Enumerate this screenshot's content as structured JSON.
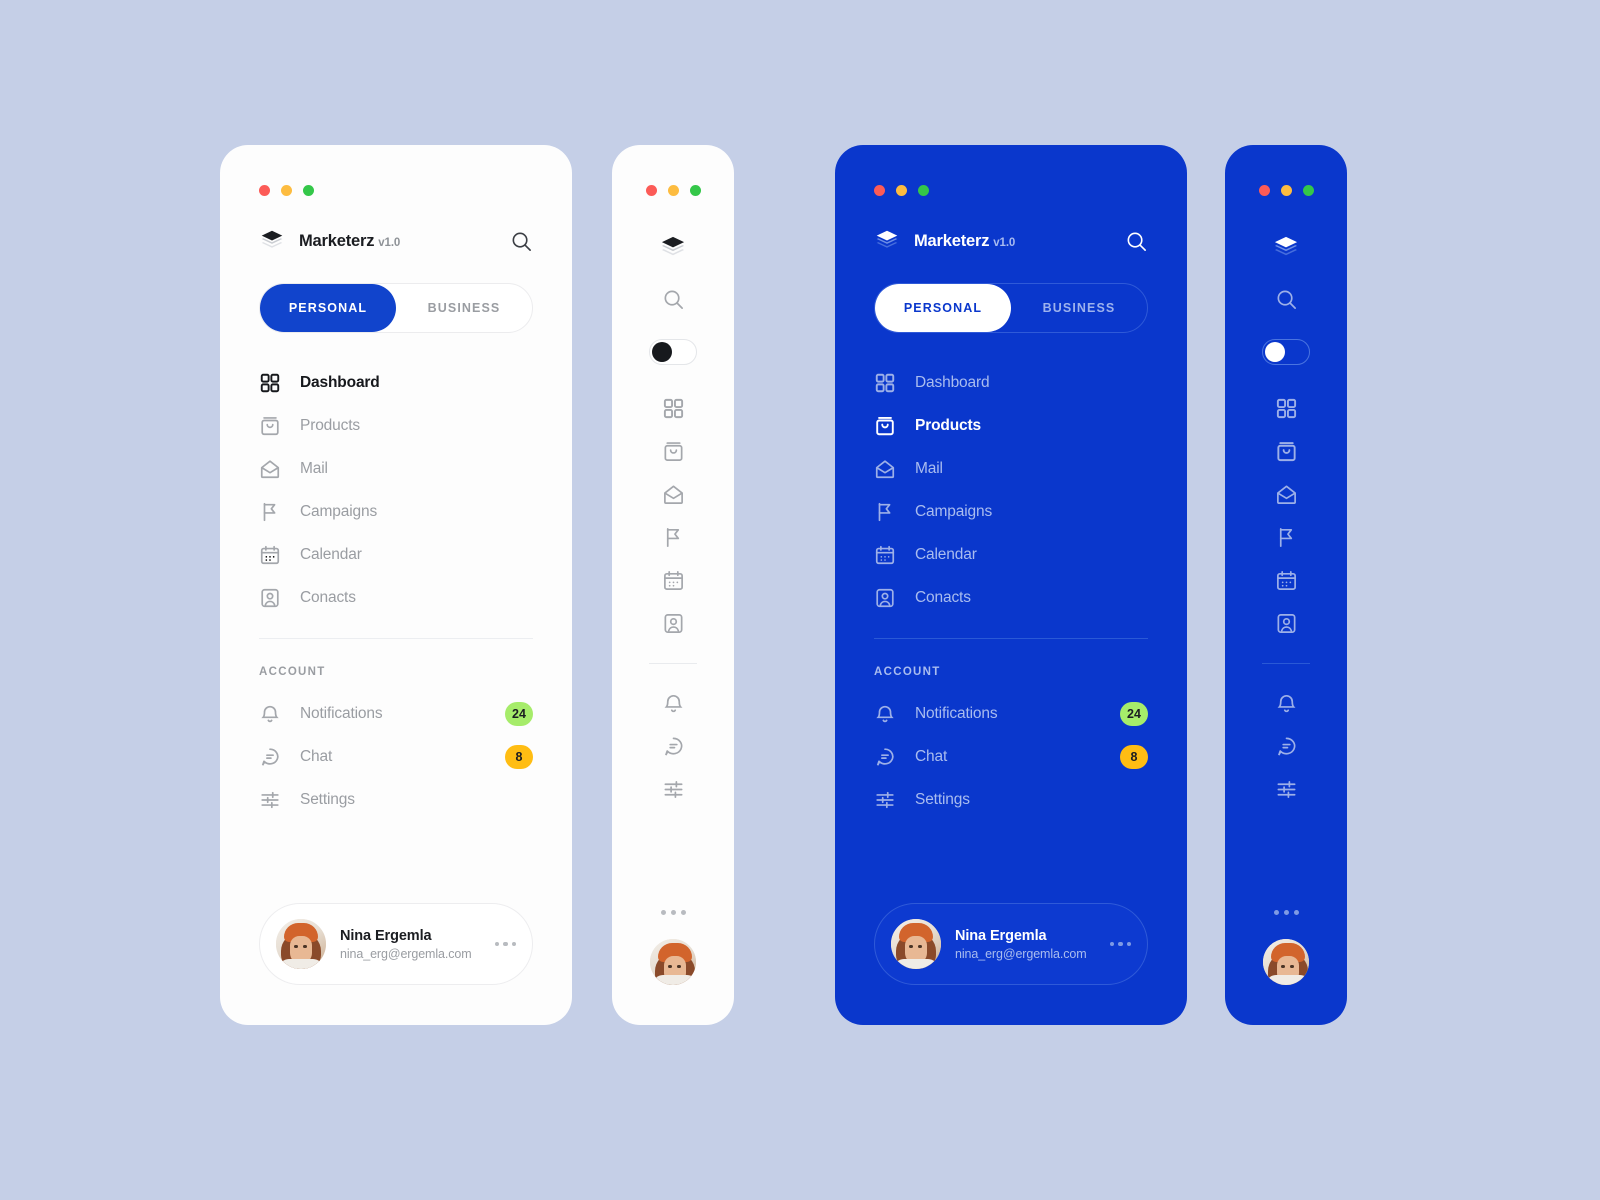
{
  "page": {
    "background_color": "#c5cfe7",
    "accent_blue": "#0a37cc",
    "tab_active_blue": "#1144cc"
  },
  "window_controls": {
    "close_color": "#fc5b57",
    "minimize_color": "#fdbc40",
    "maximize_color": "#34c749",
    "close_name": "close-dot",
    "minimize_name": "minimize-dot",
    "maximize_name": "maximize-dot"
  },
  "brand": {
    "name": "Marketerz",
    "version": "v1.0",
    "logo_icon": "layers-icon",
    "search_icon": "search-icon"
  },
  "tabs": {
    "personal": "PERSONAL",
    "business": "BUSINESS",
    "active": "PERSONAL"
  },
  "nav": {
    "items": [
      {
        "label": "Dashboard",
        "icon": "grid-icon"
      },
      {
        "label": "Products",
        "icon": "shopping-bag-icon"
      },
      {
        "label": "Mail",
        "icon": "envelope-icon"
      },
      {
        "label": "Campaigns",
        "icon": "flag-icon"
      },
      {
        "label": "Calendar",
        "icon": "calendar-icon"
      },
      {
        "label": "Conacts",
        "icon": "contact-card-icon"
      }
    ],
    "active_light": "Dashboard",
    "active_dark": "Products"
  },
  "account": {
    "section_title": "ACCOUNT",
    "items": [
      {
        "label": "Notifications",
        "icon": "bell-icon",
        "badge": "24",
        "badge_color": "#a6ec6a"
      },
      {
        "label": "Chat",
        "icon": "chat-icon",
        "badge": "8",
        "badge_color": "#ffbd13"
      },
      {
        "label": "Settings",
        "icon": "sliders-icon",
        "badge": "",
        "badge_color": ""
      }
    ]
  },
  "profile": {
    "name": "Nina Ergemla",
    "email": "nina_erg@ergemla.com",
    "avatar_name": "avatar",
    "more_icon": "more-horizontal-icon"
  },
  "rail": {
    "theme_toggle_name": "theme-toggle",
    "theme_toggle_state_light": "off",
    "theme_toggle_state_dark": "off",
    "more_icon": "more-horizontal-icon"
  }
}
